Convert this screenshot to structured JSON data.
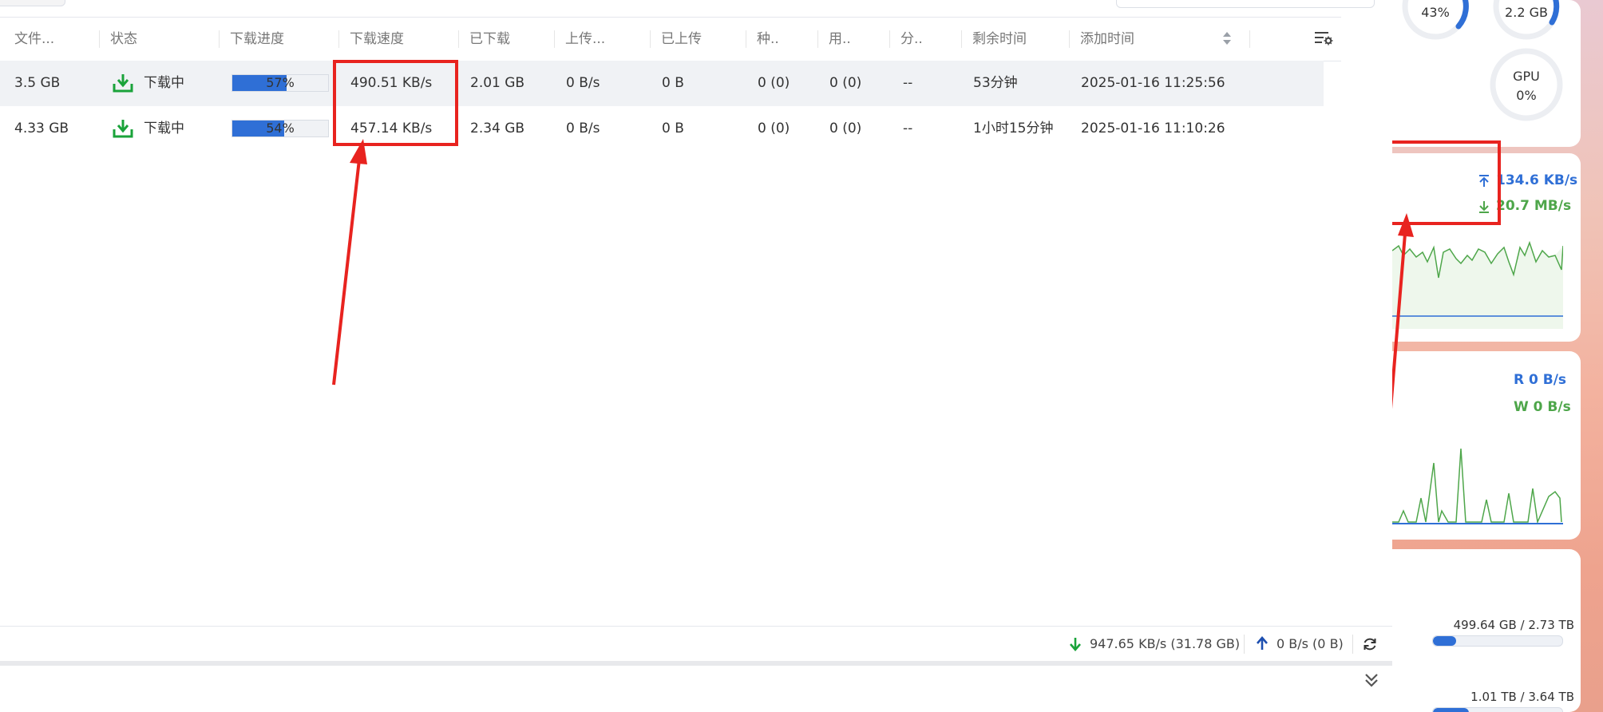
{
  "table": {
    "columns": [
      "文件...",
      "状态",
      "下载进度",
      "下载速度",
      "已下载",
      "上传...",
      "已上传",
      "种..",
      "用..",
      "分..",
      "剩余时间",
      "添加时间"
    ],
    "rows": [
      {
        "size": "3.5 GB",
        "status": "下载中",
        "progress": 57,
        "progress_label": "57%",
        "speed": "490.51 KB/s",
        "downloaded": "2.01 GB",
        "upload_speed": "0 B/s",
        "uploaded": "0 B",
        "seeds": "0 (0)",
        "peers": "0 (0)",
        "ratio": "--",
        "remaining": "53分钟",
        "added": "2025-01-16 11:25:56"
      },
      {
        "size": "4.33 GB",
        "status": "下载中",
        "progress": 54,
        "progress_label": "54%",
        "speed": "457.14 KB/s",
        "downloaded": "2.34 GB",
        "upload_speed": "0 B/s",
        "uploaded": "0 B",
        "seeds": "0 (0)",
        "peers": "0 (0)",
        "ratio": "--",
        "remaining": "1小时15分钟",
        "added": "2025-01-16 11:10:26"
      }
    ]
  },
  "status_bar": {
    "download": "947.65 KB/s (31.78 GB)",
    "upload": "0 B/s (0 B)"
  },
  "widgets": {
    "cpu": "43%",
    "mem": "2.2 GB",
    "gpu_label": "GPU",
    "gpu": "0%",
    "net_up": "134.6 KB/s",
    "net_down": "20.7 MB/s",
    "disk_read": "R  0 B/s",
    "disk_write": "W  0 B/s",
    "storage": [
      {
        "used": "499.64 GB",
        "total": "2.73 TB",
        "fill": 0.18
      },
      {
        "used": "1.01 TB",
        "total": "3.64 TB",
        "fill": 0.28
      }
    ]
  },
  "colors": {
    "accent": "#2f6fd6",
    "success": "#1aa33a",
    "annotation": "#e8231f",
    "upload_text": "#2f6fd6",
    "download_text": "#4ea64a"
  },
  "icons": [
    "download-status-icon",
    "sort-icon",
    "column-settings-icon",
    "refresh-icon",
    "collapse-icon",
    "arrow-down-icon",
    "arrow-up-icon"
  ]
}
